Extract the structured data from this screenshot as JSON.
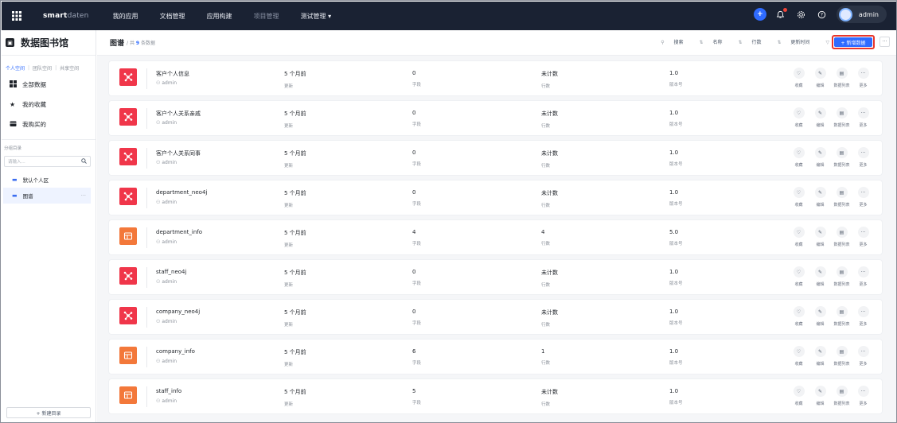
{
  "topbar": {
    "logo_main": "smart",
    "logo_dim": "daten",
    "nav": [
      "我的应用",
      "文档管理",
      "应用构建",
      "项目管理",
      "测试管理 ▾"
    ],
    "user": "admin"
  },
  "sidebar": {
    "title": "数据图书馆",
    "tabs": [
      "个人空间",
      "团队空间",
      "共享空间"
    ],
    "items": [
      "全部数据",
      "我的收藏",
      "我购买的"
    ],
    "category_label": "分组目录",
    "search_placeholder": "请输入...",
    "tree": [
      "默认个人区",
      "图谱"
    ],
    "new_dir": "+ 新建目录"
  },
  "main": {
    "title": "图谱",
    "count_prefix": "/ 共",
    "count": "9",
    "count_suffix": "条数据",
    "tools": [
      "搜索",
      "名称",
      "行数",
      "更新时间",
      "类型"
    ],
    "add_button": "+ 新增数据",
    "more": "···",
    "action_labels": [
      "收藏",
      "编辑",
      "数据列表",
      "更多"
    ],
    "labels": {
      "updated": "更新",
      "fields": "字段",
      "rows": "行数",
      "version": "版本号"
    },
    "rows": [
      {
        "name": "客户个人信息",
        "owner": "admin",
        "type": "graph",
        "updated": "5 个月前",
        "fields": "0",
        "rows": "未计数",
        "version": "1.0"
      },
      {
        "name": "客户个人关系亲戚",
        "owner": "admin",
        "type": "graph",
        "updated": "5 个月前",
        "fields": "0",
        "rows": "未计数",
        "version": "1.0"
      },
      {
        "name": "客户个人关系同事",
        "owner": "admin",
        "type": "graph",
        "updated": "5 个月前",
        "fields": "0",
        "rows": "未计数",
        "version": "1.0"
      },
      {
        "name": "department_neo4j",
        "owner": "admin",
        "type": "graph",
        "updated": "5 个月前",
        "fields": "0",
        "rows": "未计数",
        "version": "1.0"
      },
      {
        "name": "department_info",
        "owner": "admin",
        "type": "table",
        "updated": "5 个月前",
        "fields": "4",
        "rows": "4",
        "version": "5.0"
      },
      {
        "name": "staff_neo4j",
        "owner": "admin",
        "type": "graph",
        "updated": "5 个月前",
        "fields": "0",
        "rows": "未计数",
        "version": "1.0"
      },
      {
        "name": "company_neo4j",
        "owner": "admin",
        "type": "graph",
        "updated": "5 个月前",
        "fields": "0",
        "rows": "未计数",
        "version": "1.0"
      },
      {
        "name": "company_info",
        "owner": "admin",
        "type": "table",
        "updated": "5 个月前",
        "fields": "6",
        "rows": "1",
        "version": "1.0"
      },
      {
        "name": "staff_info",
        "owner": "admin",
        "type": "table",
        "updated": "5 个月前",
        "fields": "5",
        "rows": "未计数",
        "version": "1.0"
      }
    ]
  }
}
